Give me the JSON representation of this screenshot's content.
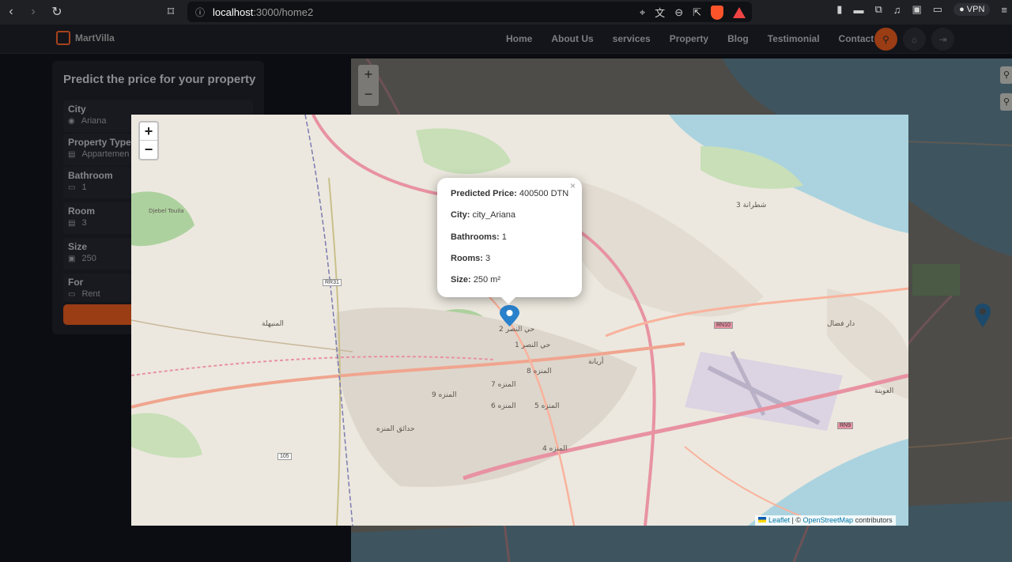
{
  "browser": {
    "url_host": "localhost",
    "url_path": ":3000/home2",
    "vpn_label": "VPN"
  },
  "site": {
    "brand": "MartVilla",
    "menu": [
      "Home",
      "About Us",
      "services",
      "Property",
      "Blog",
      "Testimonial",
      "Contact"
    ]
  },
  "form": {
    "title": "Predict the price for your property",
    "fields": [
      {
        "label": "City",
        "value": "Ariana"
      },
      {
        "label": "Property Type",
        "value": "Appartemen"
      },
      {
        "label": "Bathroom",
        "value": "1"
      },
      {
        "label": "Room",
        "value": "3"
      },
      {
        "label": "Size",
        "value": "250"
      },
      {
        "label": "For",
        "value": "Rent"
      }
    ]
  },
  "map": {
    "zoom_in": "+",
    "zoom_out": "−",
    "attribution": {
      "leaflet": "Leaflet",
      "sep": " | © ",
      "osm": "OpenStreetMap",
      "suffix": " contributors"
    },
    "popup": {
      "price_label": "Predicted Price:",
      "price_value": "400500 DTN",
      "city_label": "City:",
      "city_value": "city_Ariana",
      "bath_label": "Bathrooms:",
      "bath_value": "1",
      "rooms_label": "Rooms:",
      "rooms_value": "3",
      "size_label": "Size:",
      "size_value": "250 m²",
      "close": "×"
    },
    "labels": {
      "road_rr31": "RR31",
      "road_rn10": "RN10",
      "road_rn9": "RN9",
      "road_105": "105",
      "place_1": "المنزه 9",
      "place_2": "المنزه 8",
      "place_3": "المنزه 7",
      "place_4": "المنزه 6",
      "place_5": "المنزه 5",
      "place_6": "المنزه 4",
      "place_7": "أريانة",
      "place_8": "حي النصر 2",
      "place_9": "حي النصر 1",
      "place_10": "شطرانة 3",
      "place_11": "دار فضال",
      "place_12": "العوينة",
      "place_13": "المنيهلة",
      "place_14": "حدائق المنزه",
      "place_15": "Djebel Touila"
    },
    "colors": {
      "land": "#ece8df",
      "water": "#aad3df",
      "green": "#add19e",
      "major_road": "#e892a2",
      "secondary_road": "#f9b29c",
      "marker": "#2a81cb"
    }
  }
}
